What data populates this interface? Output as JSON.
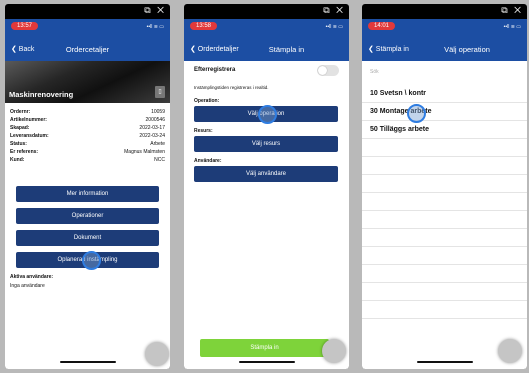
{
  "phones": [
    {
      "window_controls": "⧉ ✕",
      "time": "13:57",
      "signal": "••ll ≋ ▭",
      "nav": {
        "back": "❮ Back",
        "title": "Ordercetaljer"
      },
      "hero_title": "Maskinrenovering",
      "info": [
        {
          "k": "Ordernr:",
          "v": "10059"
        },
        {
          "k": "Artikelnummer:",
          "v": "2000546"
        },
        {
          "k": "Skapad:",
          "v": "2022-03-17"
        },
        {
          "k": "Leveransdatum:",
          "v": "2022-03-24"
        },
        {
          "k": "Status:",
          "v": "Arbete"
        },
        {
          "k": "Er referens:",
          "v": "Magnus Malmsten"
        },
        {
          "k": "Kund:",
          "v": "NCC"
        }
      ],
      "buttons": [
        "Mer information",
        "Operationer",
        "Dokument",
        "Oplanerad instämpling"
      ],
      "active_users_label": "Aktiva användare:",
      "active_users_value": "Inga användare"
    },
    {
      "window_controls": "⧉ ✕",
      "time": "13:58",
      "signal": "••ll ≋ ▭",
      "nav": {
        "back": "❮ Orderdetaljer",
        "title": "Stämpla in"
      },
      "after_label": "Efterregistrera",
      "after_note": "Instämplingstiden registreras i realtid.",
      "operation_label": "Operation:",
      "operation_button": "Välj operation",
      "resource_label": "Resurs:",
      "resource_button": "Välj resurs",
      "user_label": "Användare:",
      "user_button": "Välj användare",
      "submit": "Stämpla in"
    },
    {
      "window_controls": "⧉ ✕",
      "time": "14:01",
      "signal": "••ll ≋ ▭",
      "nav": {
        "back": "❮ Stämpla in",
        "title": "Välj operation"
      },
      "search_placeholder": "Sök",
      "items": [
        "10  Svetsn \\ kontr",
        "30  Montage arbete",
        "50  Tilläggs arbete"
      ]
    }
  ]
}
